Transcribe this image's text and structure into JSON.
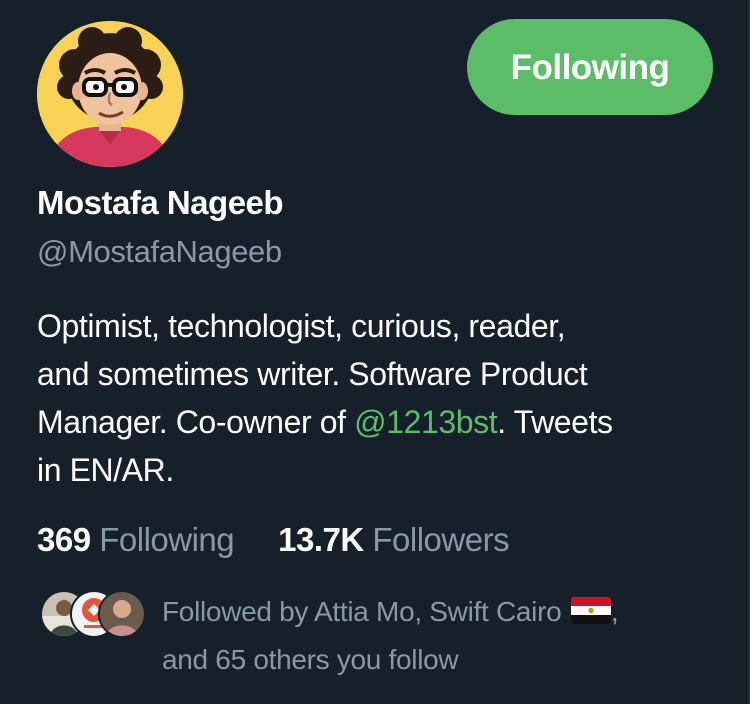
{
  "profile": {
    "name": "Mostafa Nageeb",
    "handle": "@MostafaNageeb",
    "follow_button_label": "Following",
    "avatar_icon": "cartoon-portrait-avatar"
  },
  "bio": {
    "line1": "Optimist, technologist, curious, reader,",
    "line2": "and sometimes writer. Software Product",
    "line3_before": "Manager. Co-owner of ",
    "line3_mention": "@1213bst",
    "line3_after": ". Tweets",
    "line4": "in EN/AR."
  },
  "stats": {
    "following_count": "369",
    "following_label": "Following",
    "followers_count": "13.7K",
    "followers_label": "Followers"
  },
  "followed_by": {
    "line1_text": "Followed by Attia Mo, Swift Cairo",
    "flag_icon": "egypt-flag-icon",
    "line1_suffix": ",",
    "line2": "and 65 others you follow"
  },
  "colors": {
    "background": "#15202b",
    "accent": "#5cbd69",
    "secondary_text": "#8899a6",
    "primary_text": "#ffffff"
  }
}
